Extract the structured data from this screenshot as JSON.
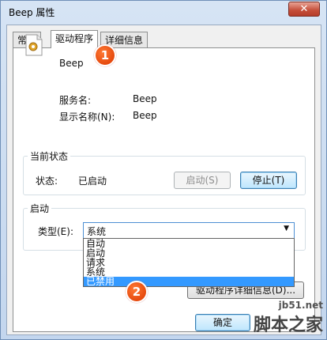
{
  "window": {
    "title": "Beep 属性",
    "close_glyph": "✕"
  },
  "tabs": [
    {
      "label": "常规"
    },
    {
      "label": "驱动程序"
    },
    {
      "label": "详细信息"
    }
  ],
  "badges": {
    "first": "1",
    "second": "2"
  },
  "header": {
    "name": "Beep",
    "icon": "gear-service-icon"
  },
  "info": {
    "service_name_label": "服务名:",
    "service_name_value": "Beep",
    "display_name_label": "显示名称(N):",
    "display_name_value": "Beep"
  },
  "current_status": {
    "group_title": "当前状态",
    "status_label": "状态:",
    "status_value": "已启动",
    "start_button": "启动(S)",
    "stop_button": "停止(T)"
  },
  "startup": {
    "group_title": "启动",
    "type_label": "类型(E):",
    "selected": "系统",
    "options": [
      "自动",
      "启动",
      "请求",
      "系统",
      "已禁用"
    ],
    "highlighted_index": 4
  },
  "driver_details_button": "驱动程序详细信息(D)...",
  "ok_button": "确定",
  "watermark": {
    "site": "jb51.net",
    "name": "脚本之家"
  }
}
